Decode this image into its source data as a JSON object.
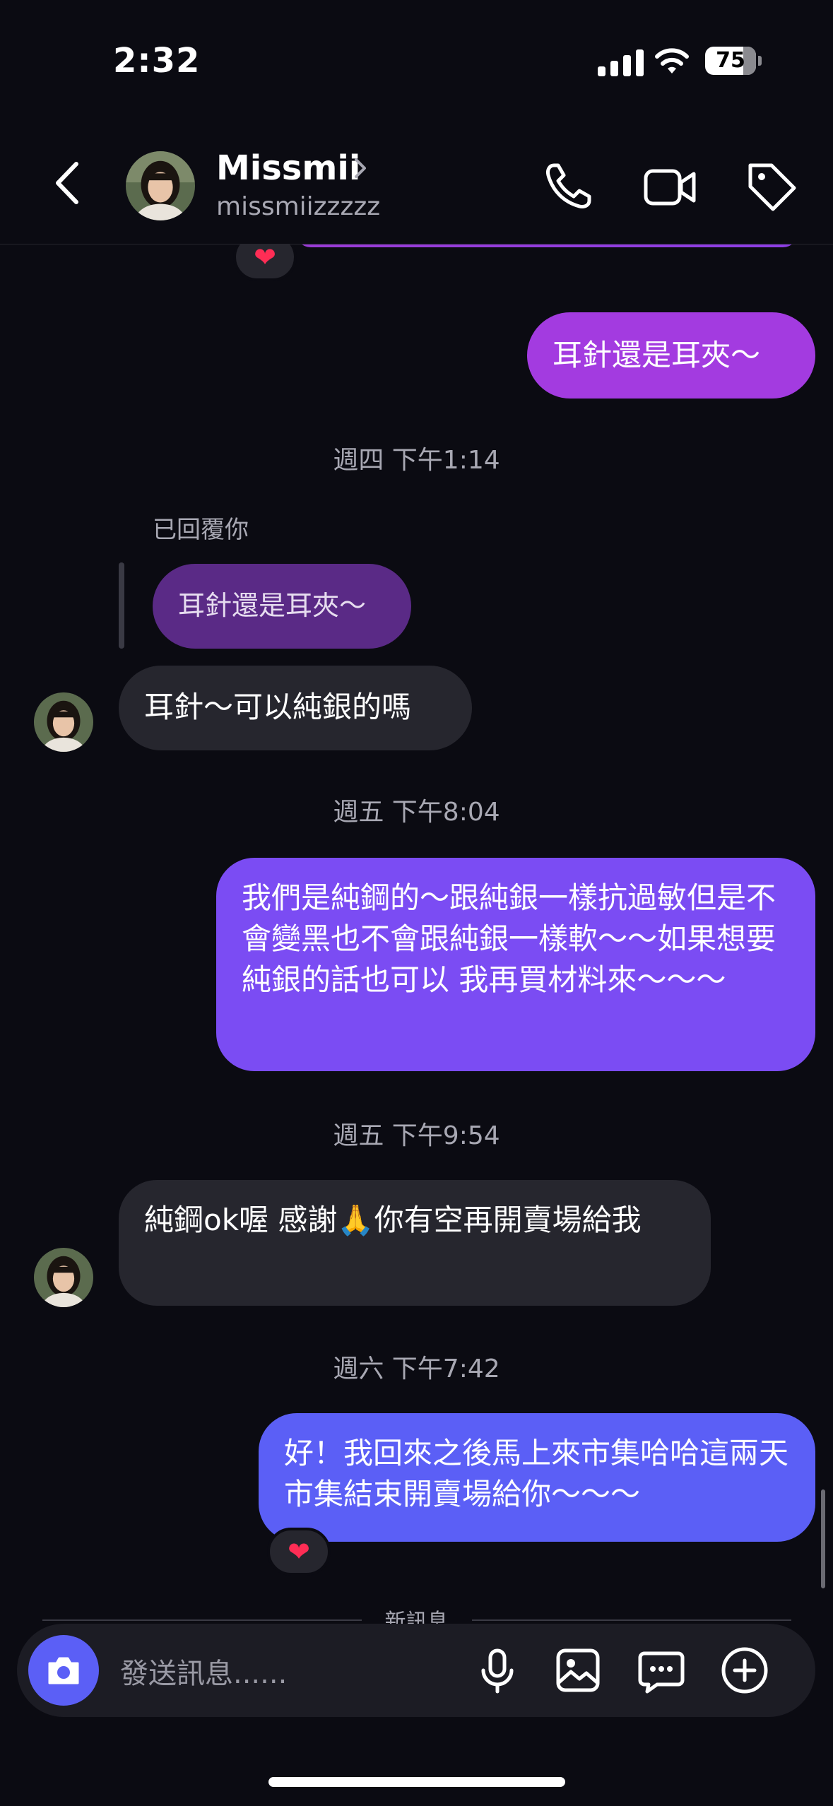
{
  "status": {
    "time": "2:32",
    "battery": "75"
  },
  "header": {
    "name": "Missmii",
    "username": "missmiizzzzz"
  },
  "messages": {
    "m1": "耳針還是耳夾～",
    "t1": "週四 下午1:14",
    "reply_label": "已回覆你",
    "quoted": "耳針還是耳夾～",
    "m2": "耳針～可以純銀的嗎",
    "t2": "週五 下午8:04",
    "m3": "我們是純鋼的～跟純銀一樣抗過敏但是不會變黑也不會跟純銀一樣軟～～如果想要純銀的話也可以 我再買材料來～～～",
    "t3": "週五 下午9:54",
    "m4": "純鋼ok喔 感謝🙏你有空再開賣場給我",
    "t4": "週六 下午7:42",
    "m5": "好！我回來之後馬上來市集哈哈這兩天市集結束開賣場給你～～～"
  },
  "reactions": {
    "heart": "❤"
  },
  "composer": {
    "placeholder": "發送訊息......",
    "new_messages": "新訊息"
  },
  "colors": {
    "accent_purple": "#a33be0",
    "accent_violet": "#7b4cf3",
    "accent_blue": "#5b5ff6",
    "incoming": "#26262e"
  },
  "icons": [
    "back-icon",
    "chevron-right-icon",
    "phone-icon",
    "video-icon",
    "tag-icon",
    "camera-icon",
    "mic-icon",
    "image-icon",
    "sticker-icon",
    "plus-icon"
  ]
}
